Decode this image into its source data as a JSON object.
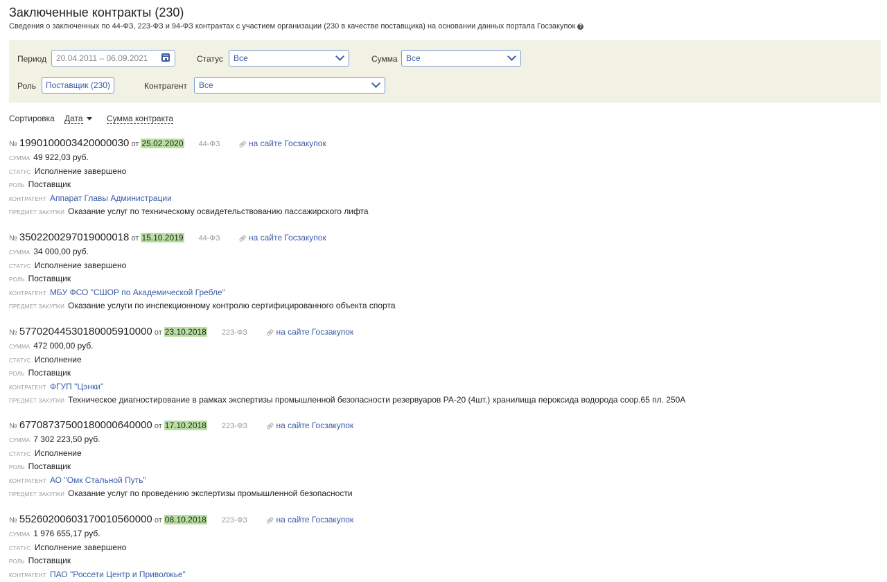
{
  "header": {
    "title": "Заключенные контракты (230)",
    "subtitle": "Сведения о заключенных по 44-ФЗ, 223-ФЗ и 94-ФЗ контрактах с участием организации (230 в качестве поставщика) на основании данных портала Госзакупок",
    "help_icon": "question-circle-icon"
  },
  "filters": {
    "period_label": "Период",
    "period_placeholder": "20.04.2011 – 06.09.2021",
    "status_label": "Статус",
    "status_value": "Все",
    "sum_label": "Сумма",
    "sum_value": "Все",
    "role_label": "Роль",
    "role_value": "Поставщик (230)",
    "counterparty_label": "Контрагент",
    "counterparty_value": "Все"
  },
  "sort": {
    "label": "Сортировка",
    "date": "Дата",
    "amount": "Сумма контракта"
  },
  "labels": {
    "no": "№",
    "from": "от",
    "sum": "сумма",
    "status": "статус",
    "role": "роль",
    "counterparty": "контрагент",
    "subject": "предмет закупки",
    "link": "на сайте Госзакупок"
  },
  "contracts": [
    {
      "number": "1990100003420000030",
      "date": "25.02.2020",
      "law": "44-ФЗ",
      "sum": "49 922,03 руб.",
      "status": "Исполнение завершено",
      "role": "Поставщик",
      "counterparty": "Аппарат Главы Администрации",
      "subject": "Оказание услуг по техническому освидетельствованию пассажирского лифта"
    },
    {
      "number": "3502200297019000018",
      "date": "15.10.2019",
      "law": "44-ФЗ",
      "sum": "34 000,00 руб.",
      "status": "Исполнение завершено",
      "role": "Поставщик",
      "counterparty": "МБУ ФСО \"СШОР по Академической Гребле\"",
      "subject": "Оказание услуги по инспекционному контролю сертифицированного объекта спорта"
    },
    {
      "number": "57702044530180005910000",
      "date": "23.10.2018",
      "law": "223-ФЗ",
      "sum": "472 000,00 руб.",
      "status": "Исполнение",
      "role": "Поставщик",
      "counterparty": "ФГУП \"Цэнки\"",
      "subject": "Техническое диагностирование в рамках экспертизы промышленной безопасности резервуаров РА-20 (4шт.) хранилища пероксида водорода соор.65 пл. 250А"
    },
    {
      "number": "67708737500180000640000",
      "date": "17.10.2018",
      "law": "223-ФЗ",
      "sum": "7 302 223,50 руб.",
      "status": "Исполнение",
      "role": "Поставщик",
      "counterparty": "АО \"Омк Стальной Путь\"",
      "subject": "Оказание услуг по проведению экспертизы промышленной безопасности"
    },
    {
      "number": "55260200603170010560000",
      "date": "08.10.2018",
      "law": "223-ФЗ",
      "sum": "1 976 655,17 руб.",
      "status": "Исполнение завершено",
      "role": "Поставщик",
      "counterparty": "ПАО \"Россети Центр и Приволжье\"",
      "subject": ""
    }
  ]
}
